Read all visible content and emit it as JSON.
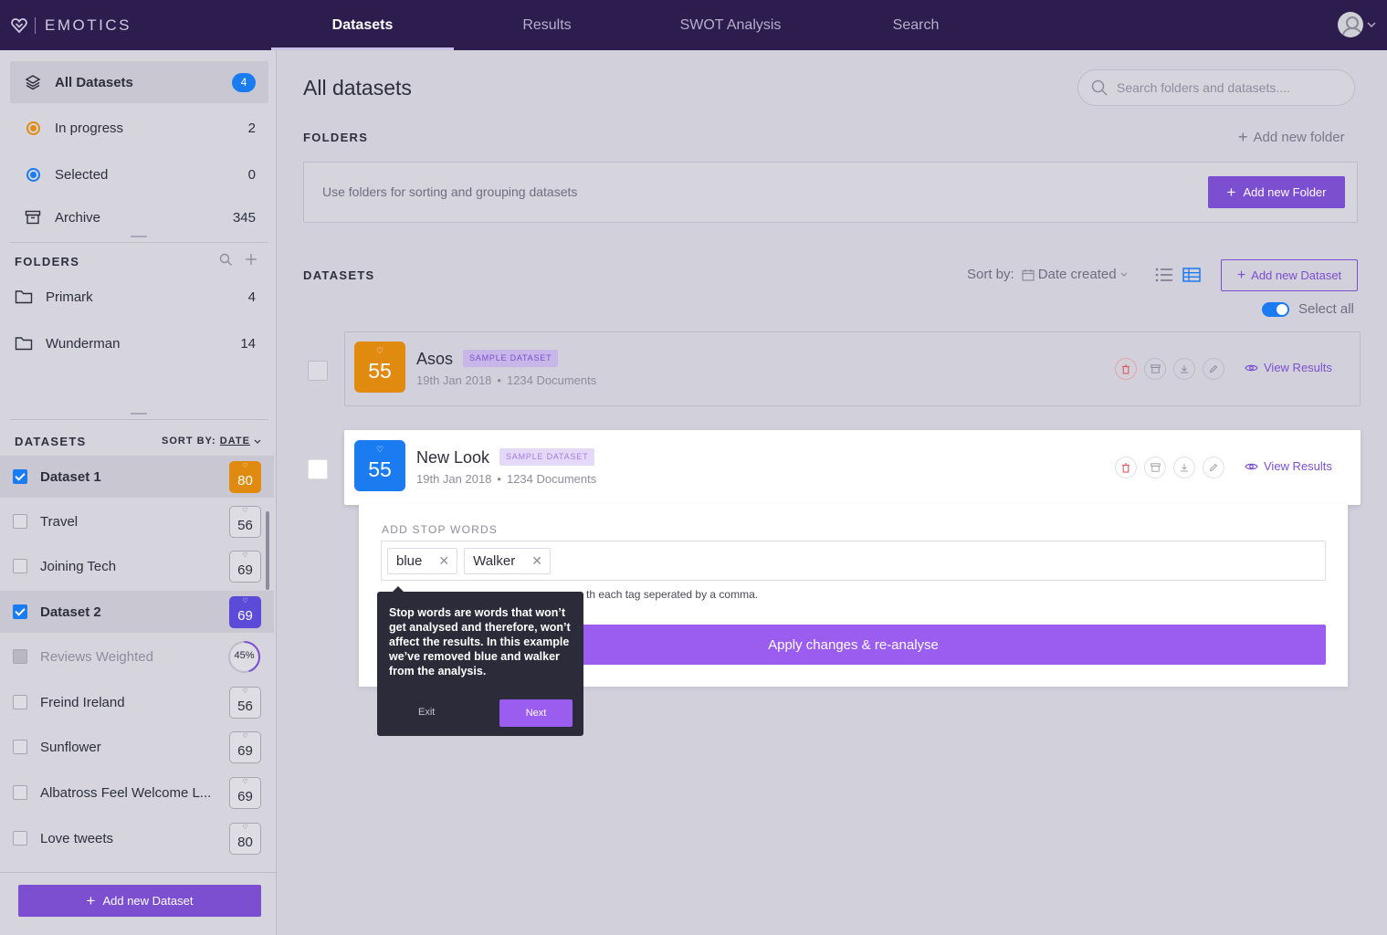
{
  "app": {
    "brand": "EMOTICS"
  },
  "nav": {
    "tabs": [
      "Datasets",
      "Results",
      "SWOT Analysis",
      "Search"
    ],
    "active": "Datasets"
  },
  "sidebar": {
    "top_items": [
      {
        "label": "All Datasets",
        "count": "4"
      },
      {
        "label": "In progress",
        "count": "2"
      },
      {
        "label": "Selected",
        "count": "0"
      },
      {
        "label": "Archive",
        "count": "345"
      }
    ],
    "folders_heading": "FOLDERS",
    "folders": [
      {
        "label": "Primark",
        "count": "4"
      },
      {
        "label": "Wunderman",
        "count": "14"
      }
    ],
    "datasets_heading": "DATASETS",
    "sort_by_label": "SORT BY:",
    "sort_by_value": "DATE",
    "datasets": [
      {
        "label": "Dataset 1",
        "score": "80",
        "checked": true
      },
      {
        "label": "Travel",
        "score": "56",
        "checked": false
      },
      {
        "label": "Joining Tech",
        "score": "69",
        "checked": false
      },
      {
        "label": "Dataset 2",
        "score": "69",
        "checked": true
      },
      {
        "label": "Reviews Weighted",
        "progress": "45%",
        "progress_value": 45
      },
      {
        "label": "Freind Ireland",
        "score": "56",
        "checked": false
      },
      {
        "label": "Sunflower",
        "score": "69",
        "checked": false
      },
      {
        "label": "Albatross Feel Welcome L...",
        "score": "69",
        "checked": false
      },
      {
        "label": "Love tweets",
        "score": "80",
        "checked": false
      }
    ],
    "add_button": "Add new Dataset"
  },
  "main": {
    "title": "All datasets",
    "search_placeholder": "Search folders and datasets....",
    "folders_label": "FOLDERS",
    "add_folder_link": "Add new folder",
    "folders_hint": "Use folders for sorting and grouping datasets",
    "add_folder_button": "Add new Folder",
    "datasets_label": "DATASETS",
    "sort_label": "Sort by:",
    "sort_value": "Date created",
    "add_dataset_button": "Add new Dataset",
    "select_all": "Select all",
    "cards": [
      {
        "name": "Asos",
        "tag": "SAMPLE DATASET",
        "score": "55",
        "date": "19th Jan 2018",
        "docs": "1234 Documents",
        "view": "View Results"
      },
      {
        "name": "New Look",
        "tag": "SAMPLE DATASET",
        "score": "55",
        "date": "19th Jan 2018",
        "docs": "1234 Documents",
        "view": "View Results"
      }
    ],
    "stop_words": {
      "label": "ADD STOP WORDS",
      "chips": [
        "blue",
        "Walker"
      ],
      "hint": "th each tag seperated by a comma.",
      "apply_button": "Apply changes & re-analyse"
    },
    "tooltip": {
      "text": "Stop words are words that won’t get analysed and therefore, won’t affect the results. In this example we’ve removed blue and walker from the analysis.",
      "exit": "Exit",
      "next": "Next"
    }
  },
  "colors": {
    "brand_bar": "#2c1d4e",
    "accent_purple": "#7c4fd0",
    "accent_blue": "#1b7bf0",
    "orange": "#e08a10",
    "in_progress": "#e08a10",
    "selected": "#1b7bf0",
    "delete_red": "#e05a5a"
  }
}
